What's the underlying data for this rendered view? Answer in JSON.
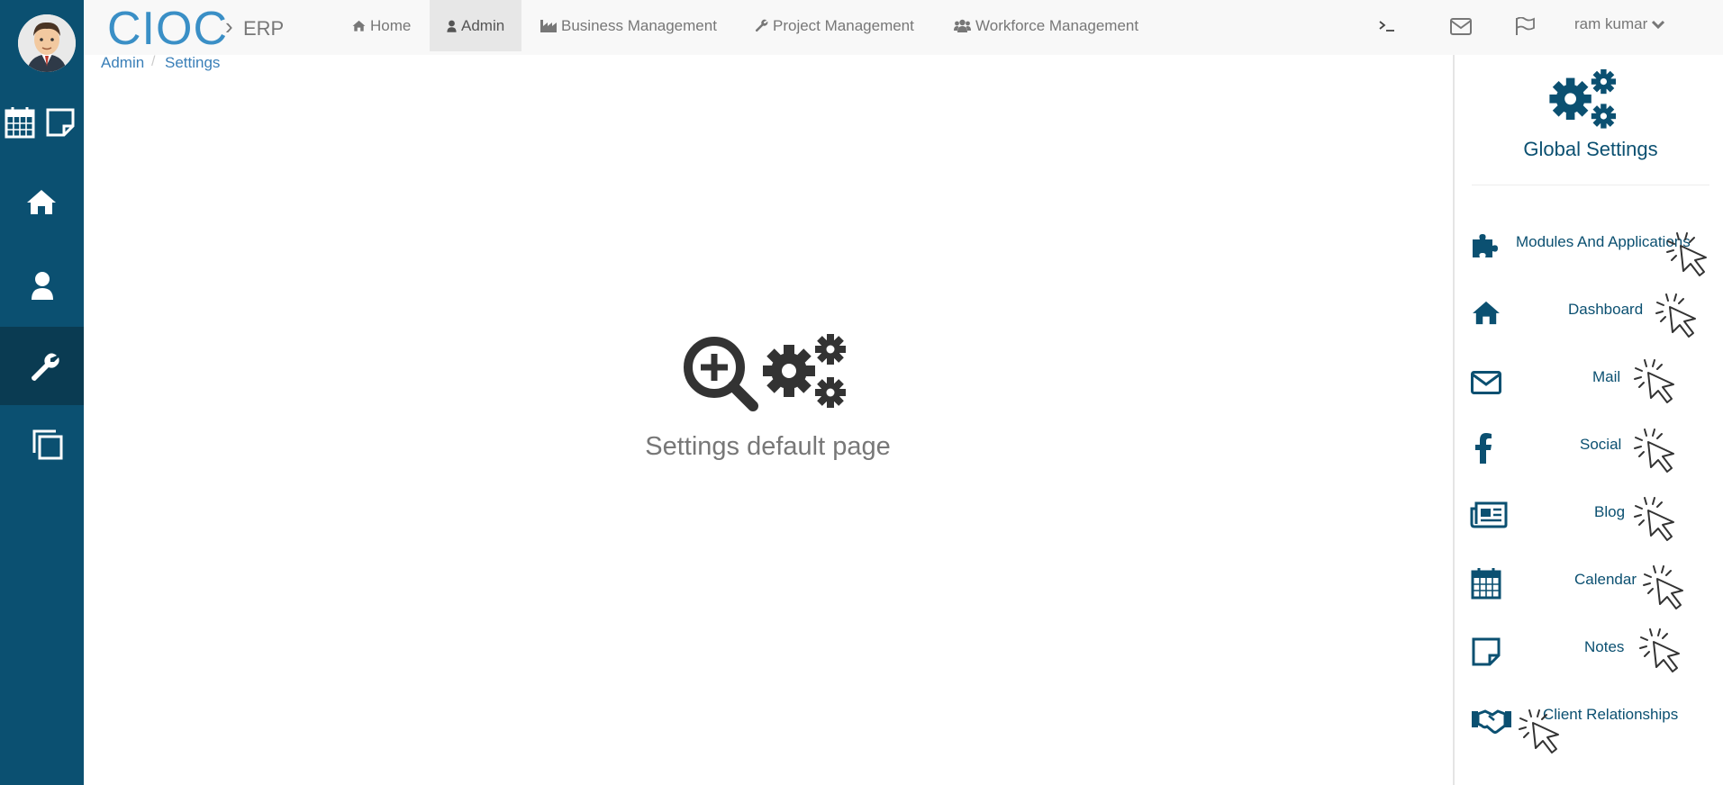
{
  "brand": {
    "name": "CIOC",
    "separator": "›",
    "sub": "ERP"
  },
  "topnav": [
    {
      "label": "Home",
      "icon": "home-icon"
    },
    {
      "label": "Admin",
      "icon": "user-icon",
      "active": true
    },
    {
      "label": "Business Management",
      "icon": "industry-icon"
    },
    {
      "label": "Project Management",
      "icon": "wrench-icon"
    },
    {
      "label": "Workforce Management",
      "icon": "users-icon"
    }
  ],
  "top_icons": [
    "terminal-icon",
    "envelope-icon",
    "flag-icon"
  ],
  "user": {
    "name": "ram kumar",
    "caret": "chevron-down-icon"
  },
  "breadcrumb": [
    "Admin",
    "Settings"
  ],
  "main": {
    "message": "Settings default page"
  },
  "right_panel": {
    "title": "Global Settings",
    "items": [
      {
        "label": "Modules And Applications",
        "icon": "puzzle-icon"
      },
      {
        "label": "Dashboard",
        "icon": "home-icon"
      },
      {
        "label": "Mail",
        "icon": "envelope-icon"
      },
      {
        "label": "Social",
        "icon": "facebook-icon"
      },
      {
        "label": "Blog",
        "icon": "newspaper-icon"
      },
      {
        "label": "Calendar",
        "icon": "calendar-icon"
      },
      {
        "label": "Notes",
        "icon": "note-icon"
      },
      {
        "label": "Client Relationships",
        "icon": "handshake-icon"
      }
    ]
  },
  "colors": {
    "sidebar": "#0b5071",
    "sidebar_active": "#0a3b52",
    "brand": "#3a8fc6",
    "panel_text": "#0b5071"
  }
}
